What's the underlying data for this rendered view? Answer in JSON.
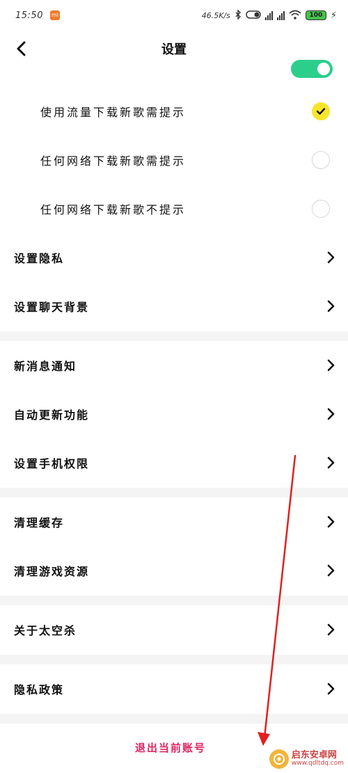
{
  "status_bar": {
    "time": "15:50",
    "carrier_badge": "mi",
    "net_speed": "46.5K/s",
    "battery_level": "100",
    "icons": [
      "bluetooth-icon",
      "vibrate-icon",
      "signal-hd-icon",
      "signal-icon",
      "wifi-icon",
      "battery-icon",
      "charging-icon"
    ]
  },
  "nav": {
    "title": "设置",
    "back_icon": "chevron-left-icon"
  },
  "download_options": [
    {
      "label": "使用流量下载新歌需提示",
      "selected": true
    },
    {
      "label": "任何网络下载新歌需提示",
      "selected": false
    },
    {
      "label": "任何网络下载新歌不提示",
      "selected": false
    }
  ],
  "section1": [
    {
      "label": "设置隐私"
    },
    {
      "label": "设置聊天背景"
    }
  ],
  "section2": [
    {
      "label": "新消息通知"
    },
    {
      "label": "自动更新功能"
    },
    {
      "label": "设置手机权限"
    }
  ],
  "section3": [
    {
      "label": "清理缓存"
    },
    {
      "label": "清理游戏资源"
    }
  ],
  "section4": [
    {
      "label": "关于太空杀"
    }
  ],
  "section5": [
    {
      "label": "隐私政策"
    }
  ],
  "logout": {
    "label": "退出当前账号"
  },
  "watermark": {
    "name": "启东安卓网",
    "url": "www.qdltdq.com"
  },
  "colors": {
    "accent_yellow": "#f7e52c",
    "toggle_green": "#2bcf8b",
    "logout_red": "#e0245e",
    "annotation_red": "#e02020",
    "section_gap": "#f4f4f4"
  }
}
